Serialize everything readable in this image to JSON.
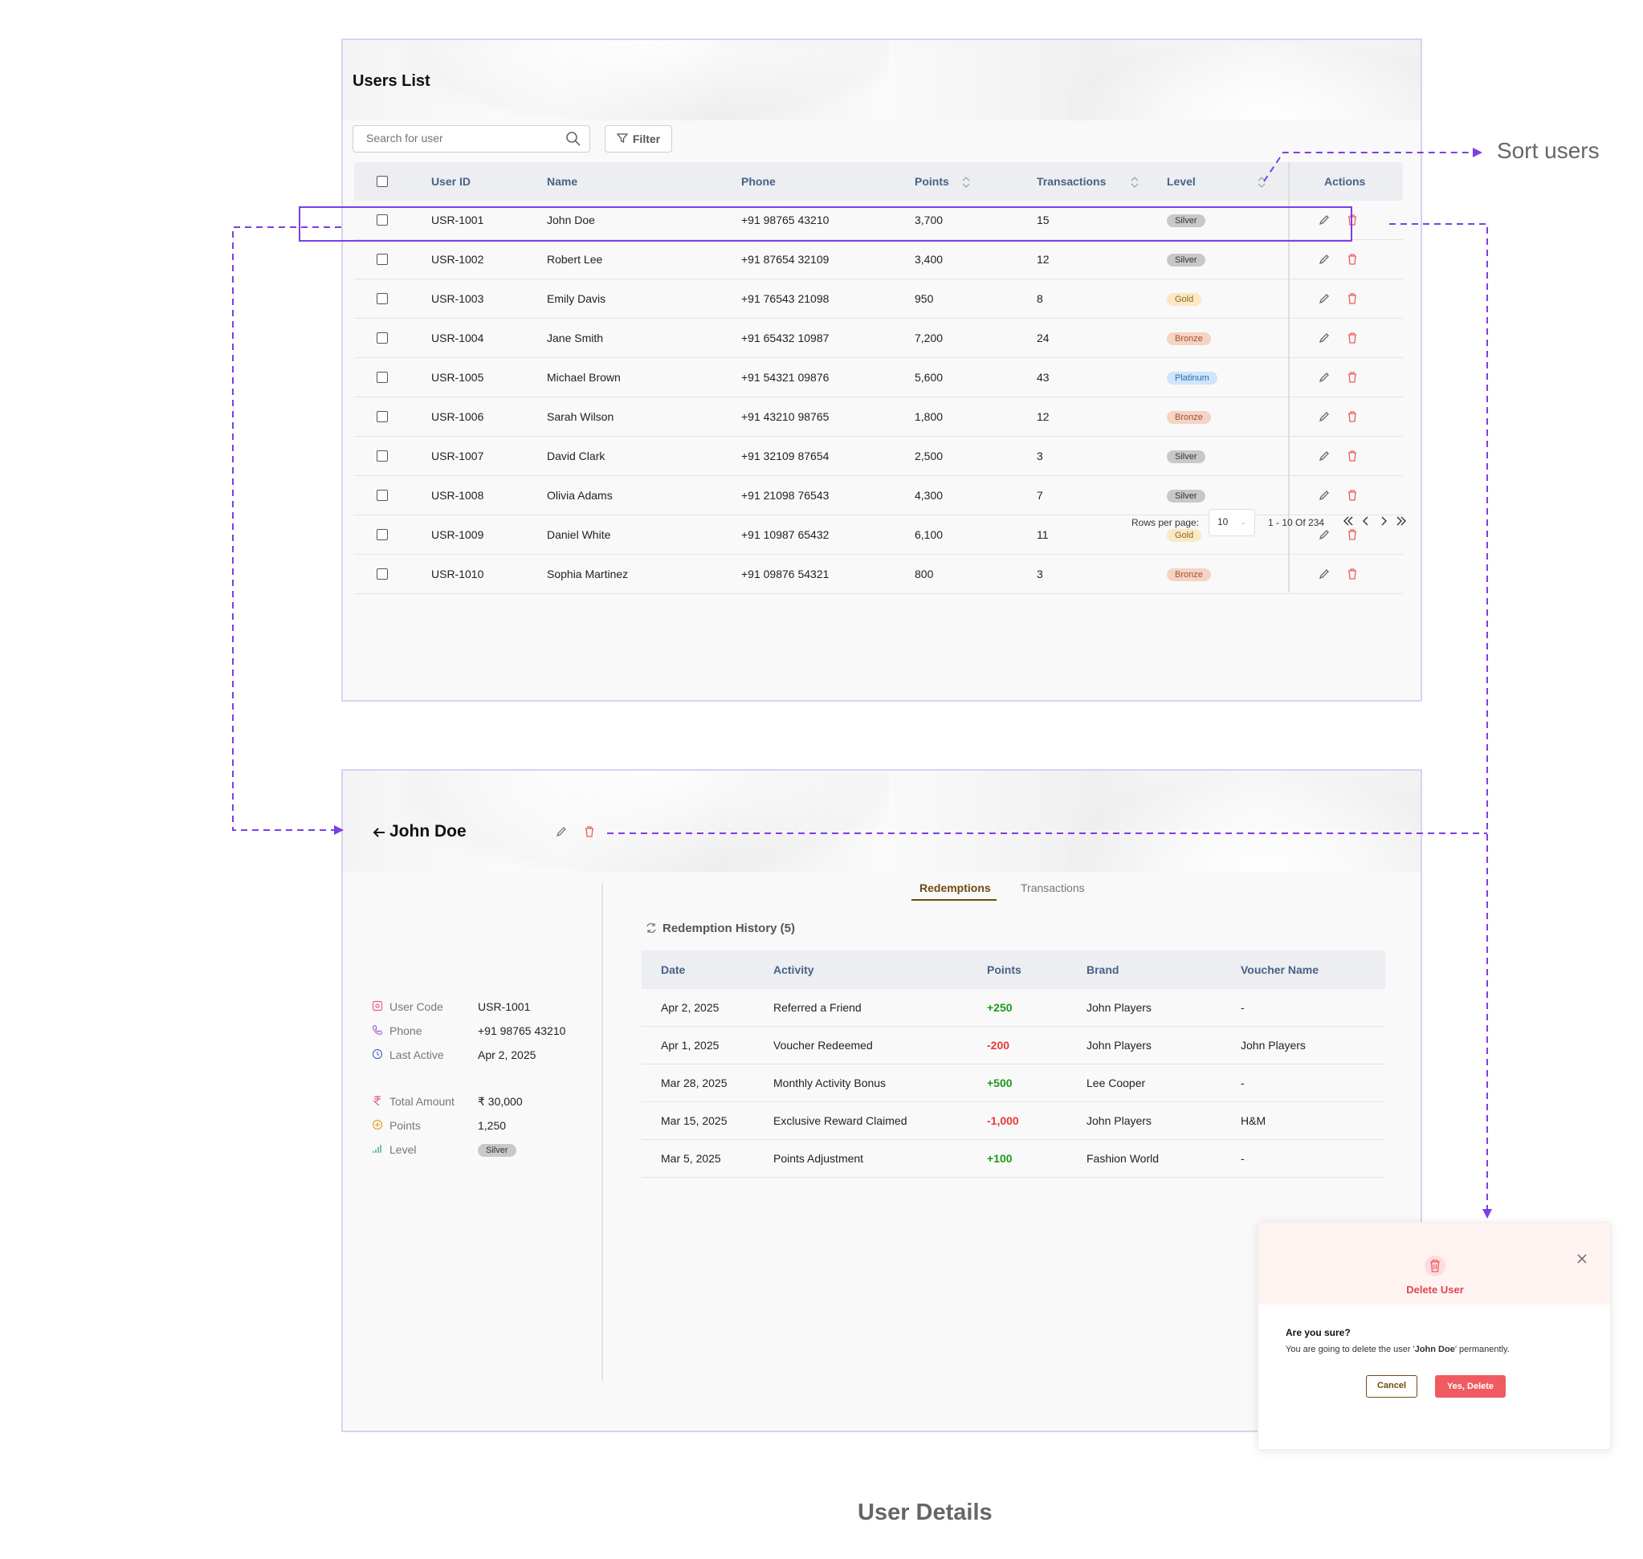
{
  "users_list": {
    "title": "Users List",
    "search_placeholder": "Search for user",
    "filter_label": "Filter",
    "columns": [
      "User ID",
      "Name",
      "Phone",
      "Points",
      "Transactions",
      "Level",
      "Actions"
    ],
    "rows": [
      {
        "id": "USR-1001",
        "name": "John Doe",
        "phone": "+91 98765 43210",
        "points": "3,700",
        "transactions": "15",
        "level": "Silver"
      },
      {
        "id": "USR-1002",
        "name": "Robert Lee",
        "phone": "+91 87654 32109",
        "points": "3,400",
        "transactions": "12",
        "level": "Silver"
      },
      {
        "id": "USR-1003",
        "name": "Emily Davis",
        "phone": "+91 76543 21098",
        "points": "950",
        "transactions": "8",
        "level": "Gold"
      },
      {
        "id": "USR-1004",
        "name": "Jane Smith",
        "phone": "+91 65432 10987",
        "points": "7,200",
        "transactions": "24",
        "level": "Bronze"
      },
      {
        "id": "USR-1005",
        "name": "Michael Brown",
        "phone": "+91 54321 09876",
        "points": "5,600",
        "transactions": "43",
        "level": "Platinum"
      },
      {
        "id": "USR-1006",
        "name": "Sarah Wilson",
        "phone": "+91 43210 98765",
        "points": "1,800",
        "transactions": "12",
        "level": "Bronze"
      },
      {
        "id": "USR-1007",
        "name": "David Clark",
        "phone": "+91 32109 87654",
        "points": "2,500",
        "transactions": "3",
        "level": "Silver"
      },
      {
        "id": "USR-1008",
        "name": "Olivia Adams",
        "phone": "+91 21098 76543",
        "points": "4,300",
        "transactions": "7",
        "level": "Silver"
      },
      {
        "id": "USR-1009",
        "name": "Daniel White",
        "phone": "+91 10987 65432",
        "points": "6,100",
        "transactions": "11",
        "level": "Gold"
      },
      {
        "id": "USR-1010",
        "name": "Sophia Martinez",
        "phone": "+91 09876 54321",
        "points": "800",
        "transactions": "3",
        "level": "Bronze"
      }
    ],
    "pagination": {
      "rows_per_page_label": "Rows per page:",
      "rows_per_page_value": "10",
      "range_text": "1 - 10 Of 234"
    }
  },
  "annotations": {
    "sort_users": "Sort users",
    "user_details": "User Details"
  },
  "user_detail": {
    "name": "John Doe",
    "fields": [
      {
        "label": "User Code",
        "value": "USR-1001",
        "icon": "id-card-icon"
      },
      {
        "label": "Phone",
        "value": "+91 98765 43210",
        "icon": "phone-icon"
      },
      {
        "label": "Last Active",
        "value": "Apr 2, 2025",
        "icon": "clock-icon"
      },
      {
        "label": "Total Amount",
        "value": "₹ 30,000",
        "icon": "rupee-icon"
      },
      {
        "label": "Points",
        "value": "1,250",
        "icon": "coin-icon"
      },
      {
        "label": "Level",
        "value": "Silver",
        "icon": "bar-chart-icon"
      }
    ],
    "tabs": [
      "Redemptions",
      "Transactions"
    ],
    "history_title": "Redemption History (5)",
    "history_columns": [
      "Date",
      "Activity",
      "Points",
      "Brand",
      "Voucher Name"
    ],
    "history_rows": [
      {
        "date": "Apr 2, 2025",
        "activity": "Referred a Friend",
        "points": "+250",
        "brand": "John Players",
        "voucher": "-"
      },
      {
        "date": "Apr 1, 2025",
        "activity": "Voucher Redeemed",
        "points": "-200",
        "brand": "John Players",
        "voucher": "John Players"
      },
      {
        "date": "Mar 28, 2025",
        "activity": "Monthly Activity Bonus",
        "points": "+500",
        "brand": "Lee Cooper",
        "voucher": "-"
      },
      {
        "date": "Mar 15, 2025",
        "activity": "Exclusive Reward Claimed",
        "points": "-1,000",
        "brand": "John Players",
        "voucher": "H&M"
      },
      {
        "date": "Mar 5, 2025",
        "activity": "Points Adjustment",
        "points": "+100",
        "brand": "Fashion World",
        "voucher": "-"
      }
    ]
  },
  "delete_modal": {
    "title": "Delete User",
    "question": "Are you sure?",
    "message_prefix": "You are going to delete the user '",
    "message_user": "John Doe",
    "message_suffix": "' permanently.",
    "cancel_label": "Cancel",
    "confirm_label": "Yes, Delete"
  },
  "colors": {
    "accent_purple": "#7b3fe4",
    "brand_brown": "#6e4a14",
    "danger_red": "#ef5b61",
    "positive_green": "#1a9a1a",
    "negative_red": "#e53935",
    "silver_badge": "#c8c8c8",
    "gold_badge": "#fbe8c4",
    "bronze_badge": "#f6d3c5",
    "platinum_badge": "#cfe5fb"
  }
}
